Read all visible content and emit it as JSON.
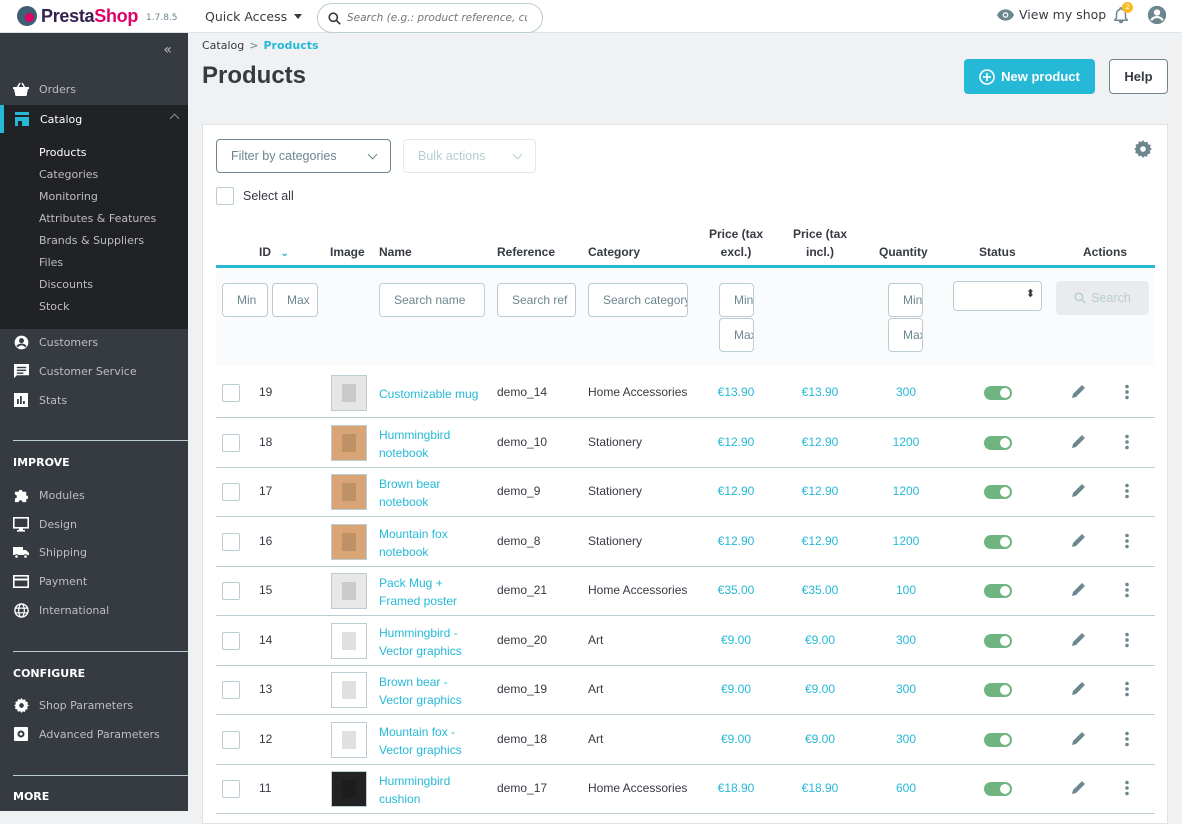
{
  "header": {
    "logo_presta": "Presta",
    "logo_shop": "Shop",
    "version": "1.7.8.5",
    "quick_access": "Quick Access",
    "search_placeholder": "Search (e.g.: product reference, custon",
    "view_shop": "View my shop",
    "notification_count": "2"
  },
  "sidebar": {
    "collapse": "«",
    "orders": "Orders",
    "catalog": "Catalog",
    "catalog_sub": [
      "Products",
      "Categories",
      "Monitoring",
      "Attributes & Features",
      "Brands & Suppliers",
      "Files",
      "Discounts",
      "Stock"
    ],
    "customers": "Customers",
    "customer_service": "Customer Service",
    "stats": "Stats",
    "improve_title": "IMPROVE",
    "improve": [
      "Modules",
      "Design",
      "Shipping",
      "Payment",
      "International"
    ],
    "configure_title": "CONFIGURE",
    "configure": [
      "Shop Parameters",
      "Advanced Parameters"
    ],
    "more_title": "MORE"
  },
  "breadcrumb": {
    "parent": "Catalog",
    "sep": ">",
    "current": "Products"
  },
  "page_title": "Products",
  "buttons": {
    "new_product": "New product",
    "help": "Help"
  },
  "toolbar": {
    "filter_categories": "Filter by categories",
    "bulk_actions": "Bulk actions",
    "select_all": "Select all"
  },
  "table": {
    "headers": {
      "id": "ID",
      "image": "Image",
      "name": "Name",
      "reference": "Reference",
      "category": "Category",
      "price_excl_1": "Price (tax",
      "price_excl_2": "excl.)",
      "price_incl_1": "Price (tax",
      "price_incl_2": "incl.)",
      "quantity": "Quantity",
      "status": "Status",
      "actions": "Actions"
    },
    "filters": {
      "id_min": "Min",
      "id_max": "Max",
      "name": "Search name",
      "reference": "Search ref",
      "category": "Search category",
      "price_min": "Min",
      "price_max": "Max",
      "qty_min": "Min",
      "qty_max": "Max",
      "search_button": "Search"
    },
    "rows": [
      {
        "id": "19",
        "name": "Customizable mug",
        "name2": "",
        "reference": "demo_14",
        "category": "Home Accessories",
        "price_excl": "€13.90",
        "price_incl": "€13.90",
        "quantity": "300",
        "status": true
      },
      {
        "id": "18",
        "name": "Hummingbird",
        "name2": "notebook",
        "reference": "demo_10",
        "category": "Stationery",
        "price_excl": "€12.90",
        "price_incl": "€12.90",
        "quantity": "1200",
        "status": true
      },
      {
        "id": "17",
        "name": "Brown bear",
        "name2": "notebook",
        "reference": "demo_9",
        "category": "Stationery",
        "price_excl": "€12.90",
        "price_incl": "€12.90",
        "quantity": "1200",
        "status": true
      },
      {
        "id": "16",
        "name": "Mountain fox",
        "name2": "notebook",
        "reference": "demo_8",
        "category": "Stationery",
        "price_excl": "€12.90",
        "price_incl": "€12.90",
        "quantity": "1200",
        "status": true
      },
      {
        "id": "15",
        "name": "Pack Mug +",
        "name2": "Framed poster",
        "reference": "demo_21",
        "category": "Home Accessories",
        "price_excl": "€35.00",
        "price_incl": "€35.00",
        "quantity": "100",
        "status": true
      },
      {
        "id": "14",
        "name": "Hummingbird -",
        "name2": "Vector graphics",
        "reference": "demo_20",
        "category": "Art",
        "price_excl": "€9.00",
        "price_incl": "€9.00",
        "quantity": "300",
        "status": true
      },
      {
        "id": "13",
        "name": "Brown bear -",
        "name2": "Vector graphics",
        "reference": "demo_19",
        "category": "Art",
        "price_excl": "€9.00",
        "price_incl": "€9.00",
        "quantity": "300",
        "status": true
      },
      {
        "id": "12",
        "name": "Mountain fox -",
        "name2": "Vector graphics",
        "reference": "demo_18",
        "category": "Art",
        "price_excl": "€9.00",
        "price_incl": "€9.00",
        "quantity": "300",
        "status": true
      },
      {
        "id": "11",
        "name": "Hummingbird",
        "name2": "cushion",
        "reference": "demo_17",
        "category": "Home Accessories",
        "price_excl": "€18.90",
        "price_incl": "€18.90",
        "quantity": "600",
        "status": true
      }
    ]
  },
  "colors": {
    "accent": "#25b9d7",
    "sidebar": "#363a41",
    "sidebar_active": "#202226",
    "toggle_on": "#70b580",
    "badge": "#fbbb22"
  }
}
